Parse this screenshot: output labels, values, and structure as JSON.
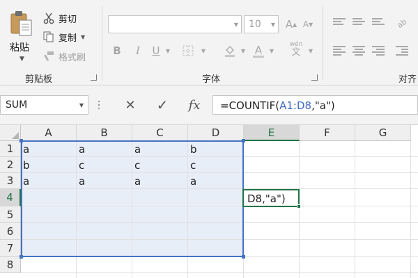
{
  "ribbon": {
    "clipboard": {
      "paste_label": "粘贴",
      "cut_label": "剪切",
      "copy_label": "复制",
      "format_painter_label": "格式刷",
      "group_label": "剪贴板"
    },
    "font": {
      "font_size": "10",
      "bold": "B",
      "italic": "I",
      "underline": "U",
      "font_color_glyph": "A",
      "phonetic_glyph": "wén",
      "phonetic_char": "文",
      "increase_glyph": "A",
      "decrease_glyph": "A",
      "group_label": "字体"
    },
    "alignment": {
      "group_label": "对齐"
    }
  },
  "formula_bar": {
    "name_box": "SUM",
    "formula_prefix": "=COUNTIF(",
    "formula_range": "A1:D8",
    "formula_suffix": ",\"a\")",
    "cancel_symbol": "✕",
    "enter_symbol": "✓",
    "fx_label": "fx"
  },
  "grid": {
    "columns": [
      "A",
      "B",
      "C",
      "D",
      "E",
      "F",
      "G"
    ],
    "rows": [
      "1",
      "2",
      "3",
      "4",
      "5",
      "6",
      "7",
      "8"
    ],
    "cells": [
      [
        "a",
        "a",
        "a",
        "b"
      ],
      [
        "b",
        "c",
        "c",
        "c"
      ],
      [
        "a",
        "a",
        "a",
        "a"
      ]
    ],
    "active_cell_text": "D8,\"a\")"
  },
  "colors": {
    "accent_green": "#217346",
    "selection_blue": "#4472c4",
    "selection_fill": "#e8eef8",
    "reference_blue": "#3f6cc4"
  },
  "icons": [
    "paste-icon",
    "cut-icon",
    "copy-icon",
    "format-painter-icon",
    "cancel-icon",
    "enter-icon",
    "fx-icon"
  ]
}
